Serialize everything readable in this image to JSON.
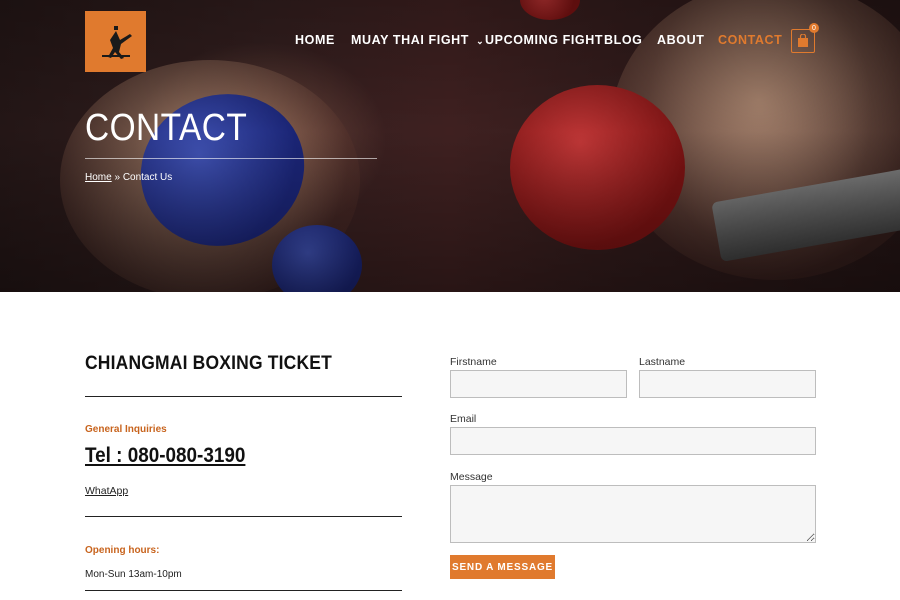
{
  "brand": {
    "accent_color": "#e07a2e",
    "logo_icon": "kickboxer-logo-icon"
  },
  "nav": {
    "items": [
      {
        "label": "HOME",
        "active": false
      },
      {
        "label": "MUAY THAI FIGHT",
        "active": false,
        "dropdown": true
      },
      {
        "label": "UPCOMING FIGHT",
        "active": false
      },
      {
        "label": "BLOG",
        "active": false
      },
      {
        "label": "ABOUT",
        "active": false
      },
      {
        "label": "CONTACT",
        "active": true
      }
    ],
    "cart": {
      "icon": "shopping-bag-icon",
      "count": "0"
    }
  },
  "hero": {
    "title": "CONTACT",
    "breadcrumb": {
      "home": "Home",
      "separator": "»",
      "current": "Contact Us"
    }
  },
  "info": {
    "company": "CHIANGMAI BOXING TICKET",
    "general_label": "General Inquiries",
    "phone": "Tel : 080-080-3190",
    "whatsapp": "WhatApp",
    "hours_label": "Opening hours:",
    "hours": "Mon-Sun 13am-10pm"
  },
  "form": {
    "firstname_label": "Firstname",
    "lastname_label": "Lastname",
    "email_label": "Email",
    "message_label": "Message",
    "firstname_value": "",
    "lastname_value": "",
    "email_value": "",
    "message_value": "",
    "submit_label": "SEND A MESSAGE"
  }
}
